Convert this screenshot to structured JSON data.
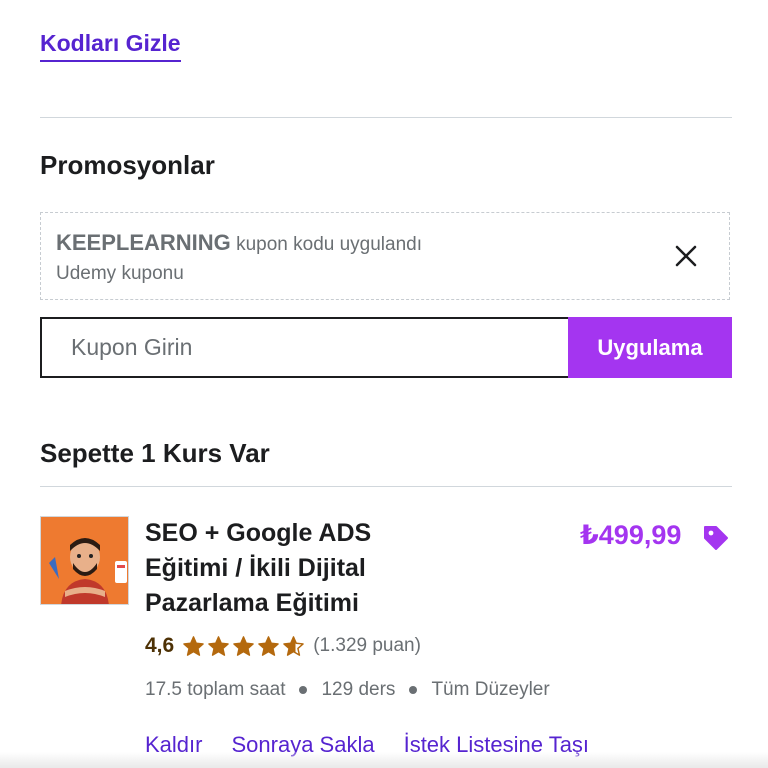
{
  "hide_codes_link": "Kodları Gizle",
  "promotions": {
    "title": "Promosyonlar",
    "applied_coupon": {
      "code": "KEEPLEARNING",
      "status_text": "kupon kodu uygulandı",
      "source_text": "Udemy kuponu"
    },
    "coupon_input_placeholder": "Kupon Girin",
    "apply_button_label": "Uygulama"
  },
  "cart": {
    "title": "Sepette 1 Kurs Var",
    "items": [
      {
        "title": "SEO + Google ADS Eğitimi / İkili Dijital Pazarlama Eğitimi",
        "price": "₺499,99",
        "price_icon": "tag-icon",
        "rating": "4,6",
        "rating_value": 4.6,
        "rating_max": 5,
        "rating_count": "(1.329 puan)",
        "meta": [
          "17.5 toplam saat",
          "129 ders",
          "Tüm Düzeyler"
        ],
        "actions": [
          "Kaldır",
          "Sonraya Sakla",
          "İstek Listesine Taşı"
        ]
      }
    ]
  },
  "colors": {
    "brand_purple": "#a435f0",
    "link_purple": "#5624d0",
    "star_orange": "#b4690e",
    "thumbnail_orange": "#ee7a30"
  }
}
